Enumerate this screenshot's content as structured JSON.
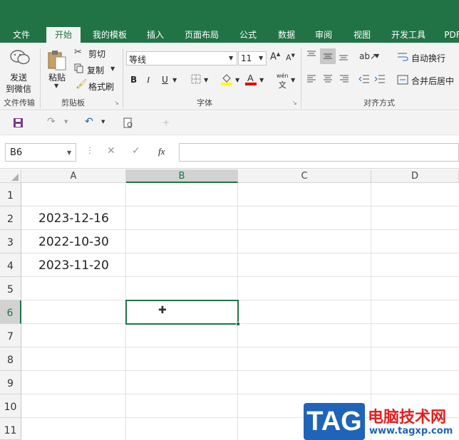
{
  "tabs": [
    "文件",
    "开始",
    "我的模板",
    "插入",
    "页面布局",
    "公式",
    "数据",
    "审阅",
    "视图",
    "开发工具",
    "PDF"
  ],
  "ribbon": {
    "send_wechat_1": "发送",
    "send_wechat_2": "到微信",
    "paste": "粘贴",
    "cut": "剪切",
    "copy": "复制",
    "format_painter": "格式刷",
    "font_name": "等线",
    "font_size": "11",
    "bold": "B",
    "italic": "I",
    "underline": "U",
    "wen": "wén",
    "wrap_text": "自动换行",
    "merge_center": "合并后居中",
    "groups": {
      "file_transfer": "文件传输",
      "clipboard": "剪贴板",
      "font": "字体",
      "alignment": "对齐方式"
    }
  },
  "formula_bar": {
    "name_box": "B6",
    "fx": "fx",
    "value": ""
  },
  "columns": [
    "A",
    "B",
    "C",
    "D"
  ],
  "rows": [
    "1",
    "2",
    "3",
    "4",
    "5",
    "6",
    "7",
    "8",
    "9",
    "10",
    "11"
  ],
  "cells": {
    "A2": "2023-12-16",
    "A3": "2022-10-30",
    "A4": "2023-11-20"
  },
  "watermark": {
    "logo": "TAG",
    "title": "电脑技术网",
    "url": "www.tagxp.com"
  },
  "colors": {
    "excel_green": "#217346",
    "selection": "#217346",
    "ribbon_bg": "#f3f3f3"
  }
}
